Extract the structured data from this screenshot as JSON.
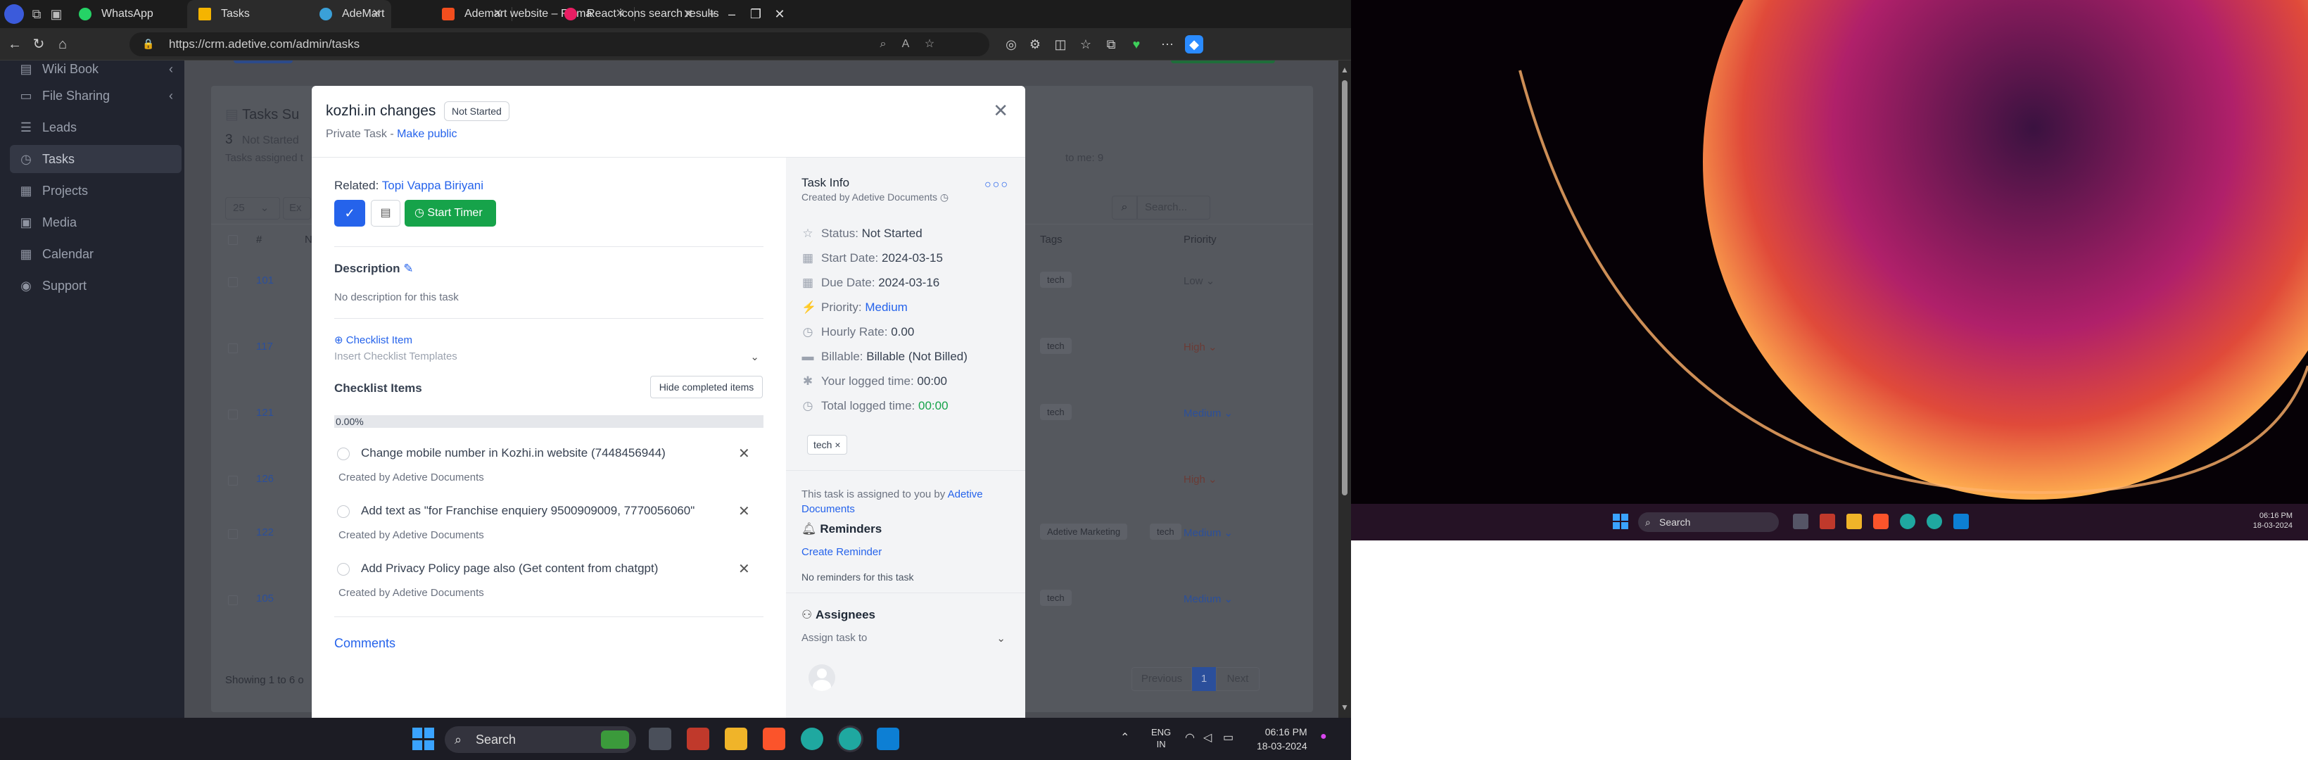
{
  "browser": {
    "tabs": [
      {
        "label": "WhatsApp",
        "color": "#25d366"
      },
      {
        "label": "Tasks",
        "color": "#f5b400"
      },
      {
        "label": "AdeMart",
        "color": "#3aa0d8"
      },
      {
        "label": "Ademart website – Figma",
        "color": "#f24e1e"
      },
      {
        "label": "React icons search results",
        "color": "#e91e63"
      }
    ],
    "url": "https://crm.adetive.com/admin/tasks"
  },
  "sidebar": {
    "items": [
      {
        "label": "Wiki Book",
        "icon": "book-icon"
      },
      {
        "label": "File Sharing",
        "icon": "folder-icon"
      },
      {
        "label": "Leads",
        "icon": "leads-icon"
      },
      {
        "label": "Tasks",
        "icon": "tasks-icon"
      },
      {
        "label": "Projects",
        "icon": "projects-icon"
      },
      {
        "label": "Media",
        "icon": "media-icon"
      },
      {
        "label": "Calendar",
        "icon": "calendar-icon"
      },
      {
        "label": "Support",
        "icon": "support-icon"
      }
    ]
  },
  "background": {
    "summary_title": "Tasks Su",
    "count": "3",
    "count_label": "Not Started",
    "assigned_note": "Tasks assigned t",
    "assigned_to_me": "to me: 9",
    "per_page": "25",
    "export": "Ex",
    "search_placeholder": "Search...",
    "col_hash": "#",
    "col_n": "N",
    "col_tags": "Tags",
    "col_priority": "Priority",
    "rows": [
      {
        "id": "101",
        "tag": "tech",
        "tag2": "",
        "priority": "Low"
      },
      {
        "id": "117",
        "tag": "tech",
        "tag2": "",
        "priority": "High"
      },
      {
        "id": "121",
        "tag": "tech",
        "tag2": "",
        "priority": "Medium"
      },
      {
        "id": "126",
        "tag": "",
        "tag2": "",
        "priority": "High"
      },
      {
        "id": "122",
        "tag": "Adetive Marketing",
        "tag2": "tech",
        "priority": "Medium"
      },
      {
        "id": "105",
        "tag": "tech",
        "tag2": "",
        "priority": "Medium"
      }
    ],
    "showing": "Showing 1 to 6 o",
    "prev": "Previous",
    "page": "1",
    "next": "Next"
  },
  "modal": {
    "title": "kozhi.in changes",
    "status_badge": "Not Started",
    "visibility": "Private Task",
    "make_public": "Make public",
    "related_label": "Related:",
    "related_value": "Topi Vappa Biriyani",
    "start_timer": "Start Timer",
    "description_label": "Description",
    "description_text": "No description for this task",
    "checklist_item_link": "Checklist Item",
    "insert_templates": "Insert Checklist Templates",
    "checklist_items_label": "Checklist Items",
    "hide_completed": "Hide completed items",
    "progress": "0.00%",
    "checklist": [
      {
        "text": "Change mobile number in Kozhi.in website (7448456944)",
        "by": "Created by Adetive Documents"
      },
      {
        "text": "Add text as \"for Franchise enquiery 9500909009, 7770056060\"",
        "by": "Created by Adetive Documents"
      },
      {
        "text": "Add Privacy Policy page also (Get content from chatgpt)",
        "by": "Created by Adetive Documents"
      }
    ],
    "comments": "Comments",
    "info": {
      "title": "Task Info",
      "created_by": "Created by Adetive Documents",
      "status_label": "Status:",
      "status_value": "Not Started",
      "start_label": "Start Date:",
      "start_value": "2024-03-15",
      "due_label": "Due Date:",
      "due_value": "2024-03-16",
      "priority_label": "Priority:",
      "priority_value": "Medium",
      "rate_label": "Hourly Rate:",
      "rate_value": "0.00",
      "billable_label": "Billable:",
      "billable_value": "Billable (Not Billed)",
      "logged_label": "Your logged time:",
      "logged_value": "00:00",
      "total_label": "Total logged time:",
      "total_value": "00:00",
      "tag": "tech",
      "assigned_text": "This task is assigned to you by",
      "assigned_by": "Adetive",
      "assigned_by2": "Documents",
      "reminders_label": "Reminders",
      "create_reminder": "Create Reminder",
      "no_reminders": "No reminders for this task",
      "assignees_label": "Assignees",
      "assign_to": "Assign task to"
    }
  },
  "desktop": {
    "search": "Search",
    "time": "06:16 PM",
    "date": "18-03-2024"
  },
  "taskbar": {
    "search": "Search",
    "lang1": "ENG",
    "lang2": "IN",
    "time": "06:16 PM",
    "date": "18-03-2024"
  }
}
